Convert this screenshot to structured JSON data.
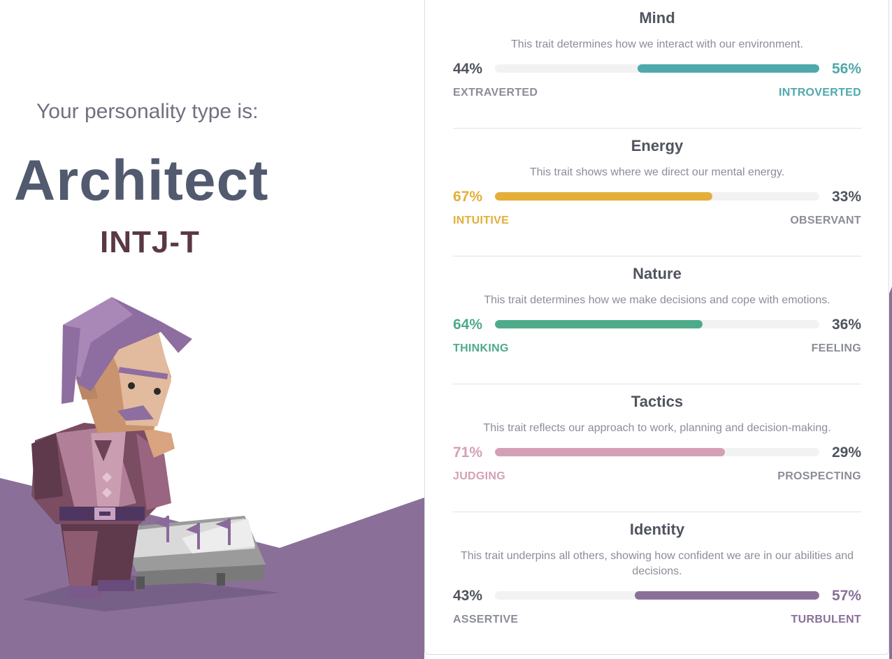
{
  "intro_text": "Your personality type is:",
  "type_name": "Architect",
  "type_code": "INTJ-T",
  "colors": {
    "background_shape": "#8a7099",
    "mind": "#4fa9ac",
    "energy": "#e4ae3a",
    "nature": "#4eab8a",
    "tactics": "#d4a0b6",
    "identity": "#8a7099",
    "neutral_text": "#50545f",
    "muted_text": "#8b8e98"
  },
  "traits": [
    {
      "title": "Mind",
      "description": "This trait determines how we interact with our environment.",
      "left_percent": "44%",
      "right_percent": "56%",
      "left_label": "EXTRAVERTED",
      "right_label": "INTROVERTED",
      "dominant": "right",
      "dominant_value": 0.56,
      "color": "#4fa9ac"
    },
    {
      "title": "Energy",
      "description": "This trait shows where we direct our mental energy.",
      "left_percent": "67%",
      "right_percent": "33%",
      "left_label": "INTUITIVE",
      "right_label": "OBSERVANT",
      "dominant": "left",
      "dominant_value": 0.67,
      "color": "#e4ae3a"
    },
    {
      "title": "Nature",
      "description": "This trait determines how we make decisions and cope with emotions.",
      "left_percent": "64%",
      "right_percent": "36%",
      "left_label": "THINKING",
      "right_label": "FEELING",
      "dominant": "left",
      "dominant_value": 0.64,
      "color": "#4eab8a"
    },
    {
      "title": "Tactics",
      "description": "This trait reflects our approach to work, planning and decision-making.",
      "left_percent": "71%",
      "right_percent": "29%",
      "left_label": "JUDGING",
      "right_label": "PROSPECTING",
      "dominant": "left",
      "dominant_value": 0.71,
      "color": "#d4a0b6"
    },
    {
      "title": "Identity",
      "description": "This trait underpins all others, showing how confident we are in our abilities and decisions.",
      "left_percent": "43%",
      "right_percent": "57%",
      "left_label": "ASSERTIVE",
      "right_label": "TURBULENT",
      "dominant": "right",
      "dominant_value": 0.57,
      "color": "#8a7099"
    }
  ]
}
